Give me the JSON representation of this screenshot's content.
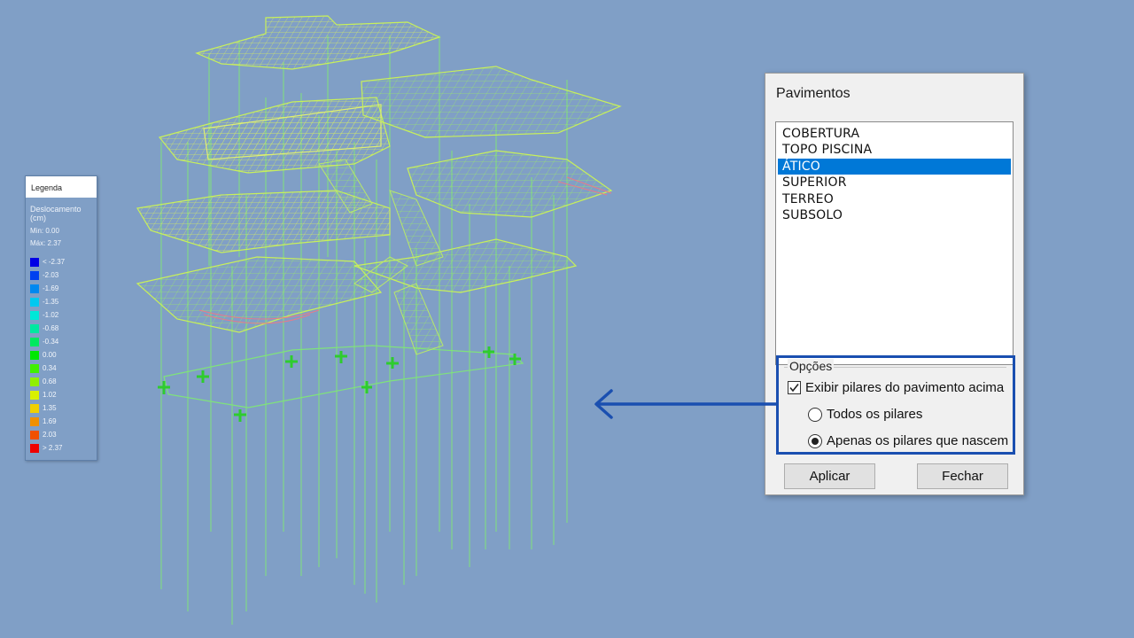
{
  "legend": {
    "title": "Legenda",
    "quantity": "Deslocamento (cm)",
    "min": "Min: 0.00",
    "max": "Máx: 2.37",
    "items": [
      {
        "label": "< -2.37",
        "color": "#0000e6"
      },
      {
        "label": "-2.03",
        "color": "#0040f0"
      },
      {
        "label": "-1.69",
        "color": "#0088f0"
      },
      {
        "label": "-1.35",
        "color": "#00c8f0"
      },
      {
        "label": "-1.02",
        "color": "#00e8d8"
      },
      {
        "label": "-0.68",
        "color": "#00e8a0"
      },
      {
        "label": "-0.34",
        "color": "#00e860"
      },
      {
        "label": "0.00",
        "color": "#00e800"
      },
      {
        "label": "0.34",
        "color": "#40f000"
      },
      {
        "label": "0.68",
        "color": "#90f000"
      },
      {
        "label": "1.02",
        "color": "#d8f000"
      },
      {
        "label": "1.35",
        "color": "#f0d000"
      },
      {
        "label": "1.69",
        "color": "#f09000"
      },
      {
        "label": "2.03",
        "color": "#f05000"
      },
      {
        "label": "> 2.37",
        "color": "#f00000"
      }
    ]
  },
  "dialog": {
    "title": "Pavimentos",
    "floors": [
      "COBERTURA",
      "TOPO PISCINA",
      "ÁTICO",
      "SUPERIOR",
      "TERREO",
      "SUBSOLO"
    ],
    "selected_floor": "ÁTICO",
    "options_group": "Opções",
    "show_columns_label": "Exibir pilares do pavimento acima",
    "show_columns_checked": true,
    "radio_all_label": "Todos os pilares",
    "radio_all_selected": false,
    "radio_born_label": "Apenas os pilares que nascem",
    "radio_born_selected": true,
    "apply_label": "Aplicar",
    "close_label": "Fechar"
  },
  "colors": {
    "background": "#809fc6",
    "highlight": "#1a4fb0",
    "selection": "#0078d7"
  }
}
